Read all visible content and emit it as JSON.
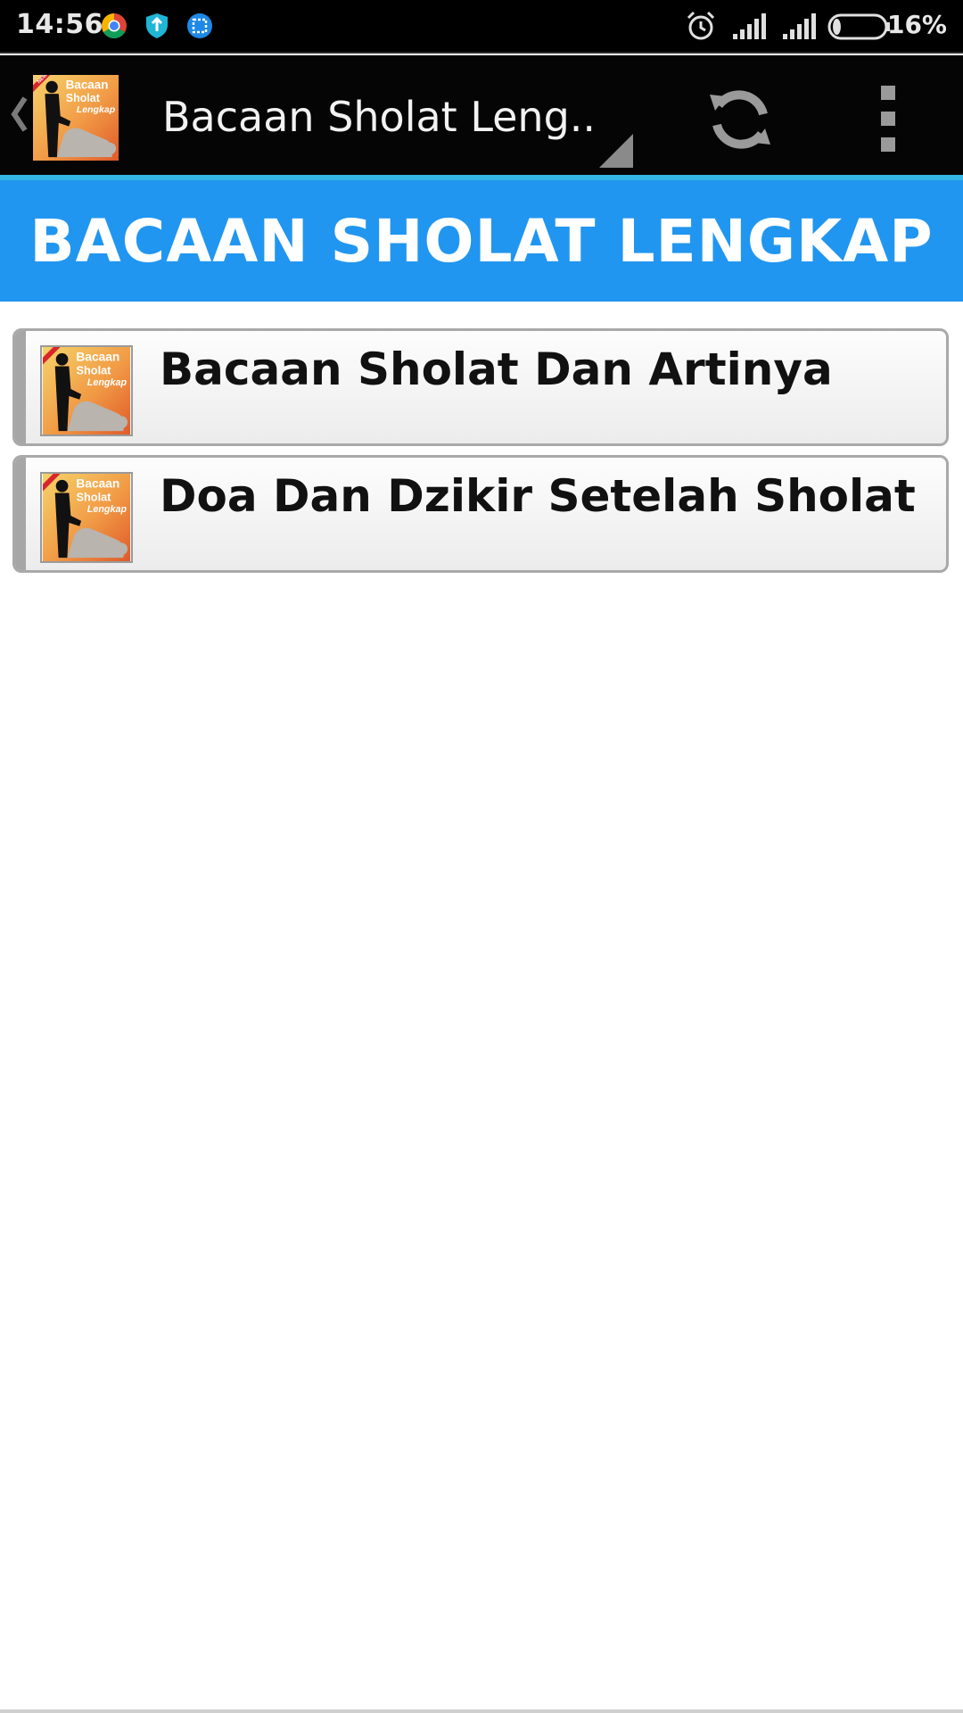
{
  "status_bar": {
    "time": "14:56",
    "left_icons": [
      "chrome-icon",
      "shield-icon",
      "screenshot-icon"
    ],
    "right_icons": [
      "alarm-icon",
      "signal-icon",
      "signal-icon",
      "battery-icon"
    ],
    "battery_percent": "16%",
    "battery_level": 0.16
  },
  "action_bar": {
    "title": "Bacaan Sholat Leng..",
    "logo_text": [
      "Bacaan",
      "Sholat",
      "Lengkap"
    ],
    "logo_badge": "NEW",
    "refresh_icon": "refresh-icon",
    "overflow_icon": "overflow-menu-icon",
    "accent_color": "#33b5e5"
  },
  "banner": {
    "title": "BACAAN SHOLAT LENGKAP",
    "background": "#2196f0"
  },
  "menu": {
    "items": [
      {
        "label": "Bacaan Sholat Dan Artinya",
        "icon": "app-thumbnail-icon"
      },
      {
        "label": "Doa Dan Dzikir Setelah Sholat",
        "icon": "app-thumbnail-icon"
      }
    ]
  }
}
